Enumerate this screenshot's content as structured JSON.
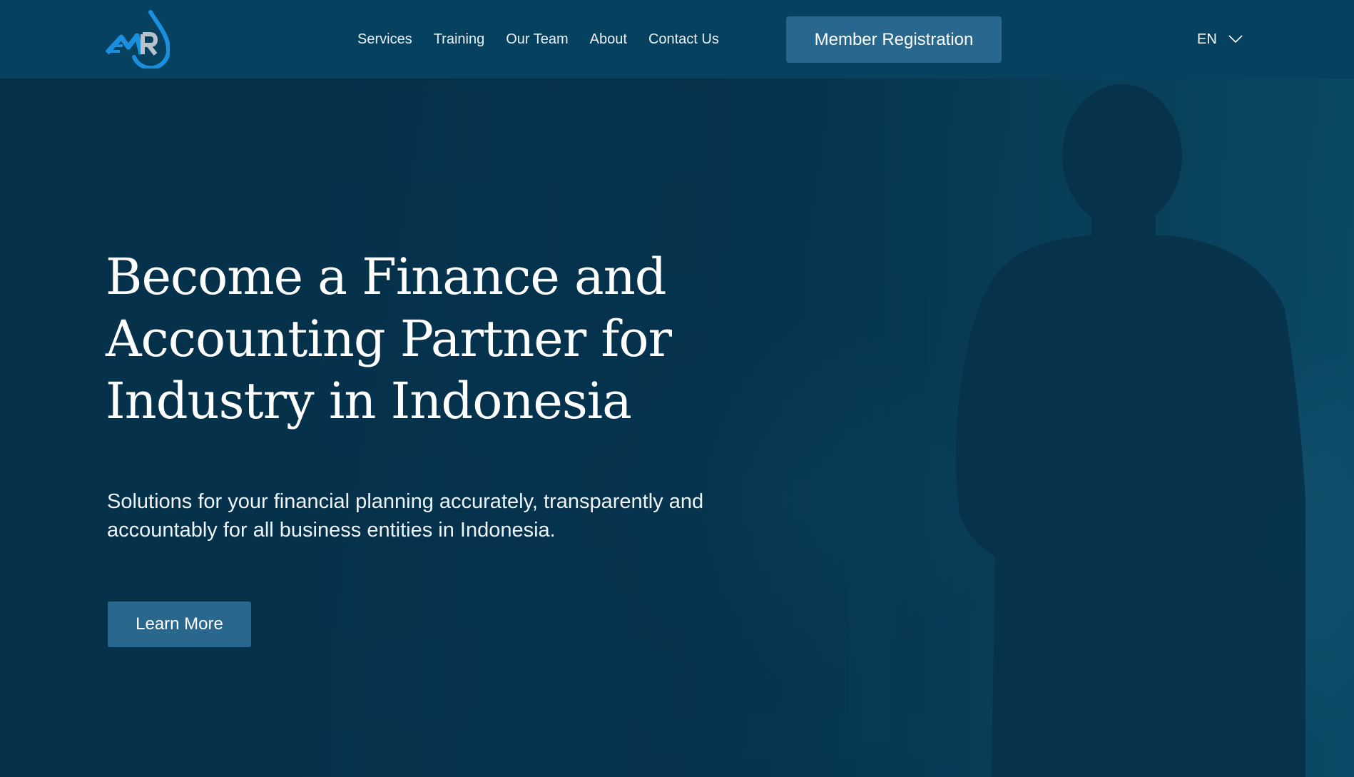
{
  "colors": {
    "header_bg": "#06425f",
    "hero_bg": "#063651",
    "button_bg": "#28688e",
    "logo_blue": "#1a8fe0",
    "logo_silver": "#b8c2cc"
  },
  "logo": {
    "icon": "droplet-mr-logo"
  },
  "nav": {
    "items": [
      {
        "label": "Services"
      },
      {
        "label": "Training"
      },
      {
        "label": "Our Team"
      },
      {
        "label": "About"
      },
      {
        "label": "Contact Us"
      }
    ]
  },
  "header": {
    "register_label": "Member Registration",
    "language": {
      "selected": "EN",
      "icon": "chevron-down-icon"
    }
  },
  "hero": {
    "title_lines": [
      "Become a Finance and",
      "Accounting Partner for",
      "Industry in Indonesia"
    ],
    "subtitle_lines": [
      "Solutions for your financial planning accurately, transparently and",
      "accountably for all business entities in Indonesia."
    ],
    "cta_label": "Learn More"
  }
}
